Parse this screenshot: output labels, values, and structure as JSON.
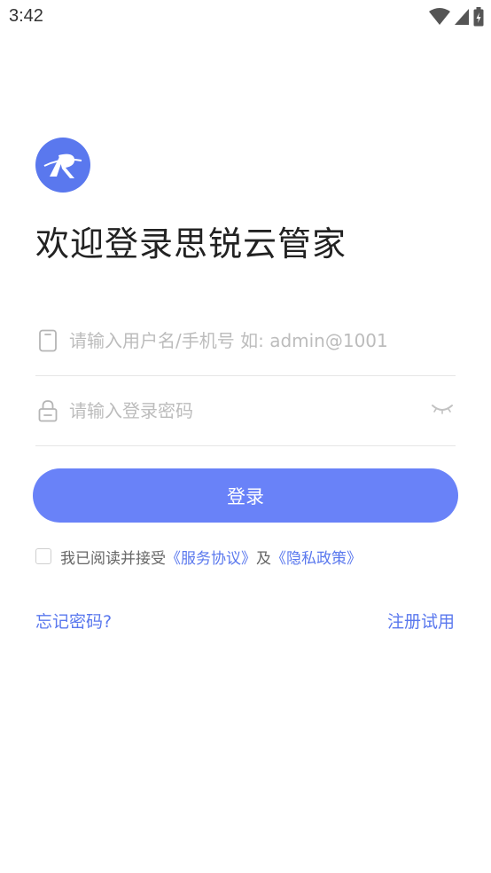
{
  "status_bar": {
    "time": "3:42",
    "icons": [
      "wifi-icon",
      "signal-icon",
      "battery-icon"
    ]
  },
  "logo": {
    "icon": "app-logo-icon",
    "letter": "R",
    "color": "#5a78ee"
  },
  "title": "欢迎登录思锐云管家",
  "form": {
    "username": {
      "placeholder": "请输入用户名/手机号 如: admin@1001",
      "value": "",
      "icon": "phone-icon"
    },
    "password": {
      "placeholder": "请输入登录密码",
      "value": "",
      "icon": "lock-icon",
      "toggle_icon": "eye-closed-icon"
    },
    "login_label": "登录"
  },
  "agreement": {
    "prefix": "我已阅读并接受",
    "service_link": "《服务协议》",
    "conjunction": "及",
    "privacy_link": "《隐私政策》",
    "checked": false
  },
  "links": {
    "forgot_password": "忘记密码?",
    "register_trial": "注册试用"
  },
  "colors": {
    "accent": "#5a78ee",
    "button": "#6982f8",
    "placeholder": "#bcbcbc"
  }
}
